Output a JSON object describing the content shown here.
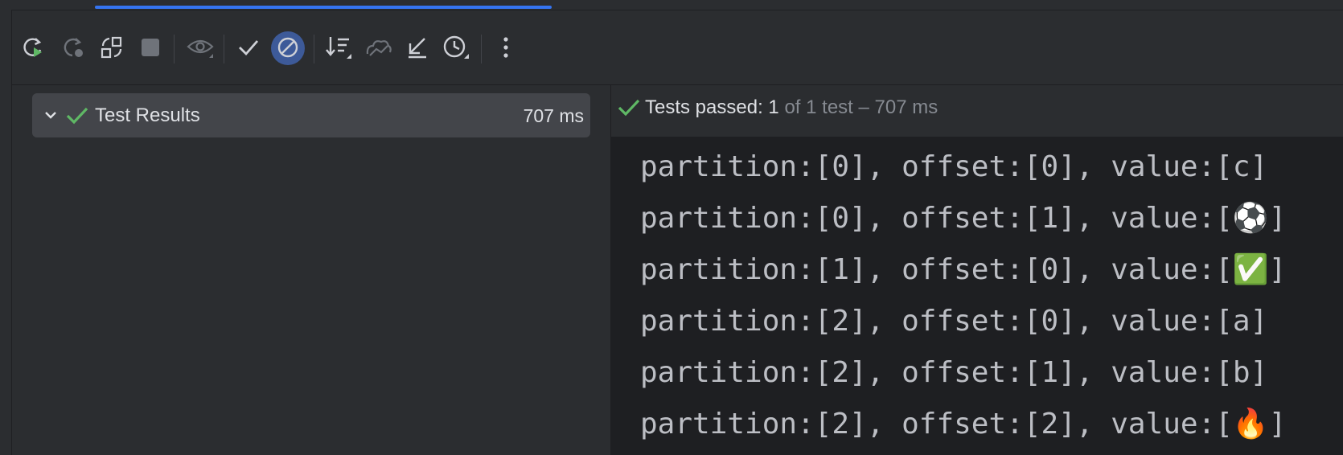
{
  "toolbar": {
    "buttons": [
      {
        "name": "rerun-icon"
      },
      {
        "name": "rerun-failed-icon"
      },
      {
        "name": "toggle-auto-test-icon"
      },
      {
        "name": "stop-icon"
      },
      {
        "name": "show-passed-eye-icon"
      },
      {
        "name": "show-passed-check-icon"
      },
      {
        "name": "show-ignored-icon",
        "active": true
      },
      {
        "name": "sort-icon"
      },
      {
        "name": "import-tests-icon"
      },
      {
        "name": "collapse-icon"
      },
      {
        "name": "history-icon"
      },
      {
        "name": "more-options-icon"
      }
    ]
  },
  "tree": {
    "root_label": "Test Results",
    "root_time": "707 ms"
  },
  "status": {
    "prefix": "Tests passed: ",
    "passed": "1",
    "suffix": " of 1 test – 707 ms"
  },
  "console": {
    "lines": [
      "partition:[0], offset:[0], value:[c]",
      "partition:[0], offset:[1], value:[⚽]",
      "partition:[1], offset:[0], value:[✅]",
      "partition:[2], offset:[0], value:[a]",
      "partition:[2], offset:[1], value:[b]",
      "partition:[2], offset:[2], value:[🔥]"
    ]
  },
  "colors": {
    "accent": "#3574f0",
    "success": "#5fb865",
    "background": "#2b2d30",
    "console_bg": "#1e1f22"
  }
}
